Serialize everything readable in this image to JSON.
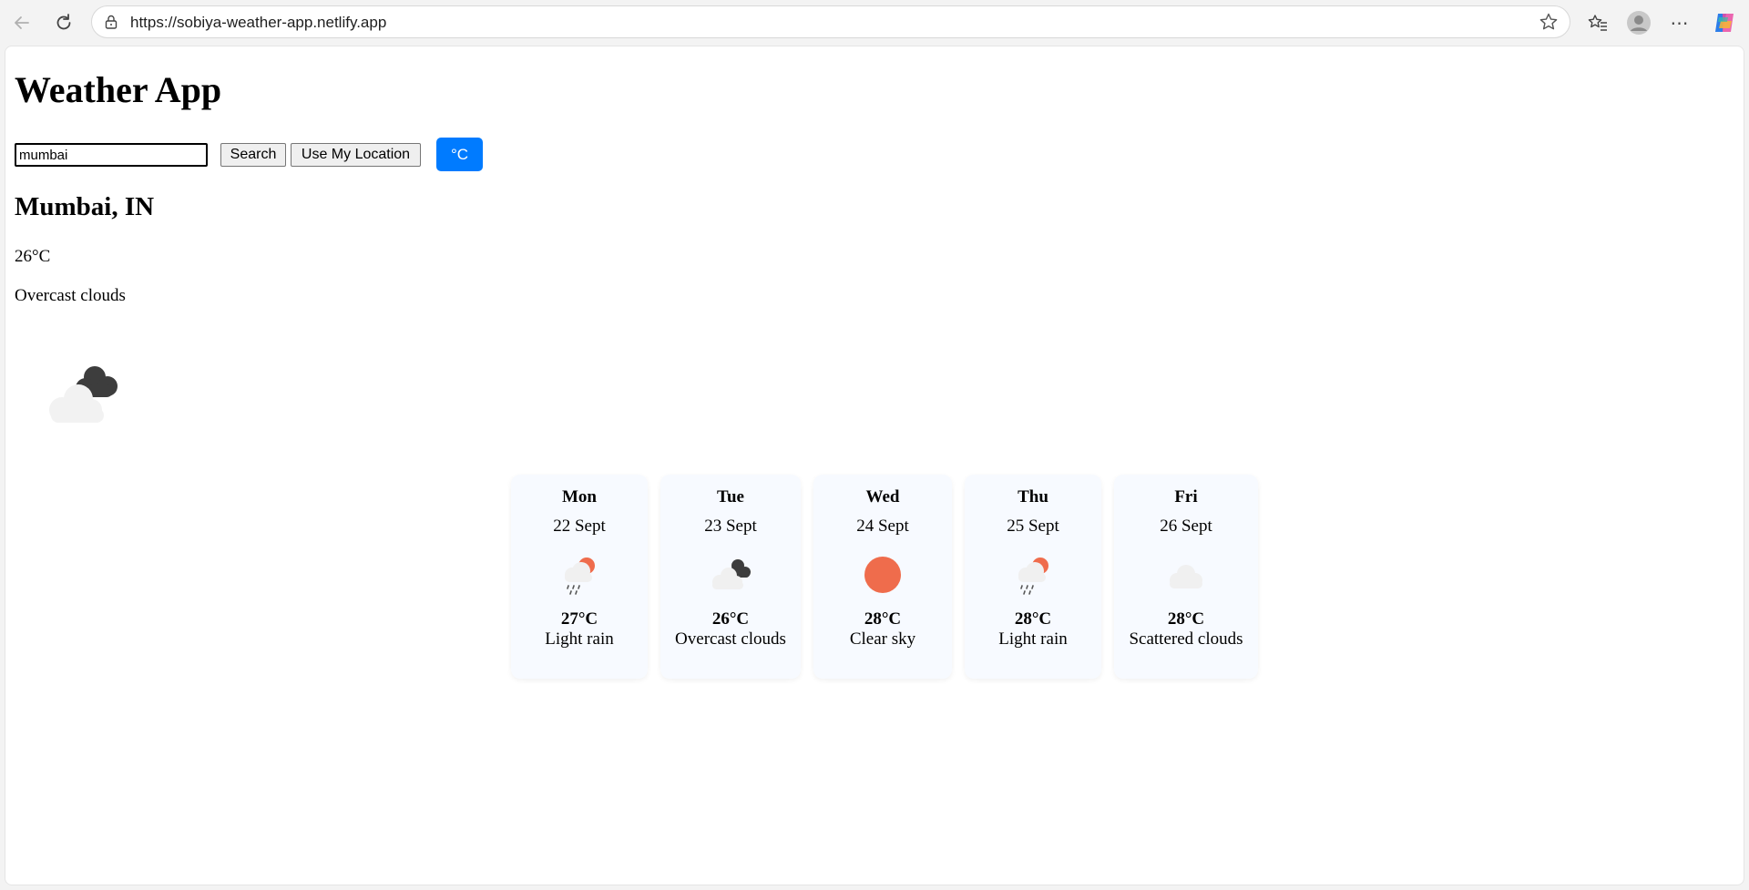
{
  "browser": {
    "url": "https://sobiya-weather-app.netlify.app"
  },
  "app": {
    "title": "Weather App",
    "search_value": "mumbai",
    "search_label": "Search",
    "location_label": "Use My Location",
    "unit_label": "°C",
    "accent_color": "#007bff"
  },
  "current": {
    "city": "Mumbai, IN",
    "temp": "26°C",
    "description": "Overcast clouds",
    "icon": "overcast-clouds-icon"
  },
  "forecast": [
    {
      "day": "Mon",
      "date": "22 Sept",
      "temp": "27°C",
      "description": "Light rain",
      "icon": "light-rain-icon"
    },
    {
      "day": "Tue",
      "date": "23 Sept",
      "temp": "26°C",
      "description": "Overcast clouds",
      "icon": "overcast-clouds-icon"
    },
    {
      "day": "Wed",
      "date": "24 Sept",
      "temp": "28°C",
      "description": "Clear sky",
      "icon": "sun-icon"
    },
    {
      "day": "Thu",
      "date": "25 Sept",
      "temp": "28°C",
      "description": "Light rain",
      "icon": "light-rain-icon"
    },
    {
      "day": "Fri",
      "date": "26 Sept",
      "temp": "28°C",
      "description": "Scattered clouds",
      "icon": "scattered-clouds-icon"
    }
  ]
}
